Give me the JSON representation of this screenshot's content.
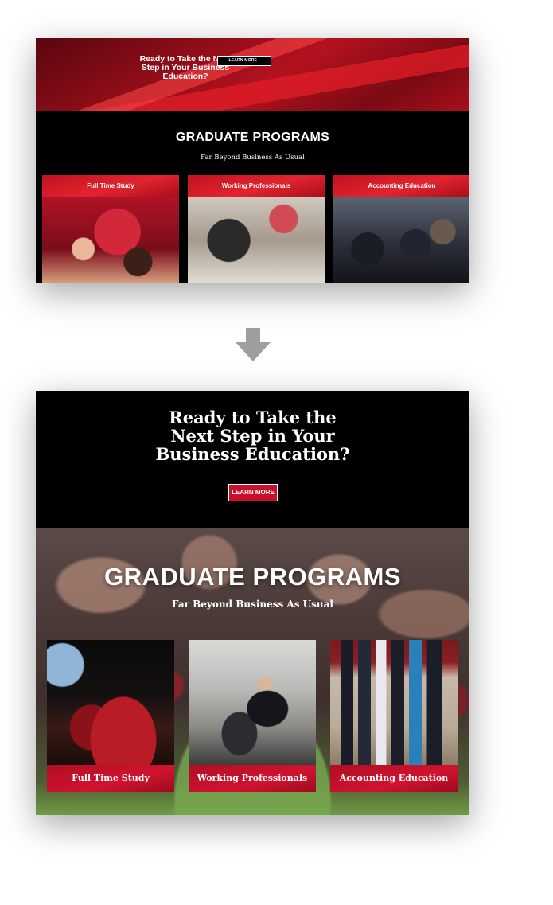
{
  "before": {
    "banner": {
      "text": "Ready to Take the Next Step in Your Business Education?",
      "learn_more": "LEARN MORE ›"
    },
    "title": "GRADUATE PROGRAMS",
    "subtitle": "Far Beyond Business As Usual",
    "tiles": [
      {
        "label": "Full Time Study"
      },
      {
        "label": "Working Professionals"
      },
      {
        "label": "Accounting Education"
      }
    ]
  },
  "arrow": {
    "icon": "down-arrow-icon",
    "color": "#9e9e9e"
  },
  "after": {
    "hero": {
      "line1": "Ready to Take the",
      "line2": "Next Step in Your",
      "line3": "Business Education?",
      "learn_more": "LEARN MORE"
    },
    "title": "GRADUATE PROGRAMS",
    "subtitle": "Far Beyond Business As Usual",
    "tiles": [
      {
        "label": "Full Time Study"
      },
      {
        "label": "Working Professionals"
      },
      {
        "label": "Accounting Education"
      }
    ]
  },
  "colors": {
    "brand_red": "#c8102e",
    "dark": "#000000"
  }
}
